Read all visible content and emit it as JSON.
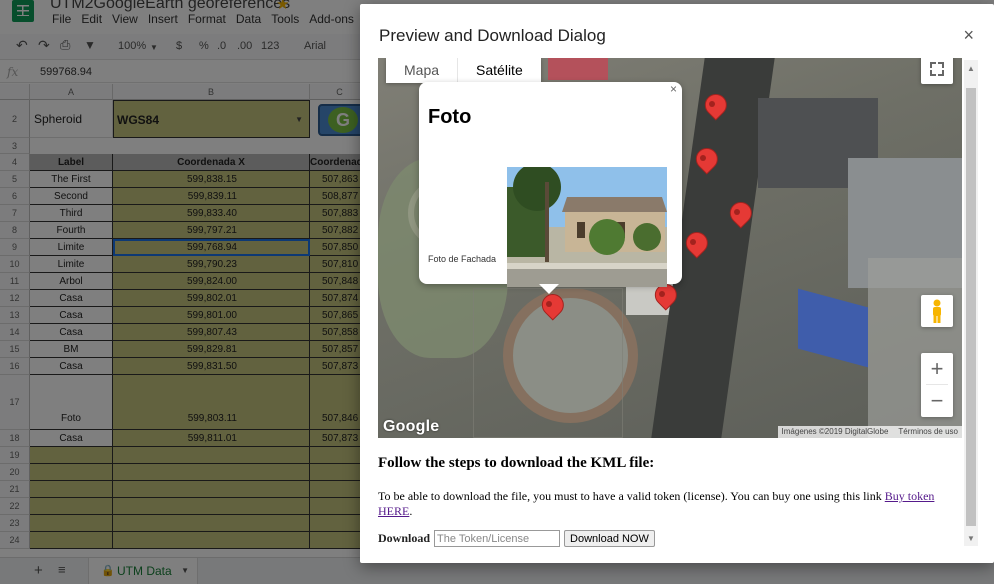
{
  "sheet": {
    "doc_title": "UTM2GoogleEarth  georeferences",
    "menu": [
      "File",
      "Edit",
      "View",
      "Insert",
      "Format",
      "Data",
      "Tools",
      "Add-ons"
    ],
    "toolbar": {
      "zoom": "100%",
      "currency": "$",
      "percent": "%",
      "dec_less": ".0",
      "dec_more": ".00",
      "number_format": "123",
      "font": "Arial"
    },
    "formula_value": "599768.94",
    "columns": [
      "A",
      "B",
      "C"
    ],
    "spheroid_label": "Spheroid",
    "spheroid_value": "WGS84",
    "header": {
      "label": "Label",
      "x": "Coordenada X",
      "y": "Coordenada Y"
    },
    "rows": [
      {
        "n": "5",
        "label": "The First",
        "x": "599,838.15",
        "y": "507,863"
      },
      {
        "n": "6",
        "label": "Second",
        "x": "599,839.11",
        "y": "508,877"
      },
      {
        "n": "7",
        "label": "Third",
        "x": "599,833.40",
        "y": "507,883"
      },
      {
        "n": "8",
        "label": "Fourth",
        "x": "599,797.21",
        "y": "507,882"
      },
      {
        "n": "9",
        "label": "Limite",
        "x": "599,768.94",
        "y": "507,850"
      },
      {
        "n": "10",
        "label": "Limite",
        "x": "599,790.23",
        "y": "507,810"
      },
      {
        "n": "11",
        "label": "Arbol",
        "x": "599,824.00",
        "y": "507,848"
      },
      {
        "n": "12",
        "label": "Casa",
        "x": "599,802.01",
        "y": "507,874"
      },
      {
        "n": "13",
        "label": "Casa",
        "x": "599,801.00",
        "y": "507,865"
      },
      {
        "n": "14",
        "label": "Casa",
        "x": "599,807.43",
        "y": "507,858"
      },
      {
        "n": "15",
        "label": "BM",
        "x": "599,829.81",
        "y": "507,857"
      },
      {
        "n": "16",
        "label": "Casa",
        "x": "599,831.50",
        "y": "507,873"
      },
      {
        "n": "17",
        "label": "Foto",
        "x": "599,803.11",
        "y": "507,846"
      },
      {
        "n": "18",
        "label": "Casa",
        "x": "599,811.01",
        "y": "507,873"
      }
    ],
    "empty_rows": [
      "19",
      "20",
      "21",
      "22",
      "23",
      "24"
    ],
    "sheet_tab": "UTM Data",
    "row_numbers": {
      "r2": "2",
      "r3": "3",
      "r4": "4"
    }
  },
  "dialog": {
    "title": "Preview and Download Dialog",
    "close_glyph": "×",
    "map": {
      "tab_map": "Mapa",
      "tab_satellite": "Satélite",
      "zoom_in": "+",
      "zoom_out": "−",
      "google_logo": "Google",
      "attribution_imagery": "Imágenes ©2019 DigitalGlobe",
      "attribution_terms": "Términos de uso",
      "info_window": {
        "title": "Foto",
        "caption": "Foto de Fachada",
        "close_glyph": "×"
      }
    },
    "heading": "Follow the steps to download the KML file:",
    "body_text": "To be able to download the file, you must to have a valid token (license). You can buy one using this link ",
    "link_text": "Buy token HERE",
    "body_end": ".",
    "download_label": "Download",
    "token_placeholder": "The Token/License",
    "download_button": "Download NOW"
  },
  "colors": {
    "sheet_data_fill": "#c4c47e",
    "header_fill": "#b8b8b8",
    "pin": "#e53935",
    "link": "#551a8b"
  }
}
